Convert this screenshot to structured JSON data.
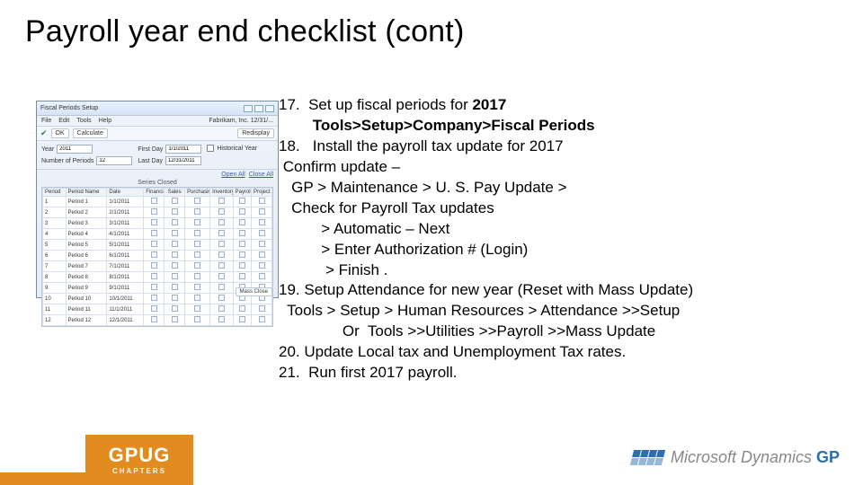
{
  "title": "Payroll year end checklist (cont)",
  "checklist": {
    "l1a": "17.  Set up fiscal periods for ",
    "l1b": "2017",
    "l2a": "        ",
    "l2b": "Tools>Setup>Company>Fiscal Periods",
    "l3": "18.   Install the payroll tax update for 2017",
    "l4": " Confirm update –",
    "l5": "   GP > Maintenance > U. S. Pay Update >",
    "l6": "   Check for Payroll Tax updates",
    "l7": "          > Automatic – Next",
    "l8": "          > Enter Authorization # (Login)",
    "l9": "           > Finish .",
    "l10": "19. Setup Attendance for new year (Reset with Mass Update)",
    "l11": "  Tools > Setup > Human Resources > Attendance >>Setup",
    "l12": "               Or  Tools >>Utilities >>Payroll >>Mass Update",
    "l13": "20. Update Local tax and Unemployment Tax rates.",
    "l14": "21.  Run first 2017 payroll."
  },
  "window": {
    "title": "Fiscal Periods Setup",
    "menu": [
      "File",
      "Edit",
      "Tools",
      "Help"
    ],
    "company": "Fabrikam, Inc.  12/31/...",
    "toolbar": {
      "ok": "OK",
      "calc": "Calculate",
      "redisplay": "Redisplay"
    },
    "params": {
      "year_label": "Year",
      "year": "2011",
      "num_label": "Number of Periods",
      "num": "12",
      "first_label": "First Day",
      "first": "1/1/2011",
      "last_label": "Last Day",
      "last": "12/31/2011",
      "hist_label": "Historical Year"
    },
    "links": {
      "open": "Open All",
      "close": "Close All"
    },
    "series_closed": "Series Closed",
    "columns": [
      "Period",
      "Period Name",
      "Date",
      "Financial",
      "Sales",
      "Purchasing",
      "Inventory",
      "Payroll",
      "Project"
    ],
    "rows": [
      {
        "p": "1",
        "n": "Period 1",
        "d": "1/1/2011"
      },
      {
        "p": "2",
        "n": "Period 2",
        "d": "2/1/2011"
      },
      {
        "p": "3",
        "n": "Period 3",
        "d": "3/1/2011"
      },
      {
        "p": "4",
        "n": "Period 4",
        "d": "4/1/2011"
      },
      {
        "p": "5",
        "n": "Period 5",
        "d": "5/1/2011"
      },
      {
        "p": "6",
        "n": "Period 6",
        "d": "6/1/2011"
      },
      {
        "p": "7",
        "n": "Period 7",
        "d": "7/1/2011"
      },
      {
        "p": "8",
        "n": "Period 8",
        "d": "8/1/2011"
      },
      {
        "p": "9",
        "n": "Period 9",
        "d": "9/1/2011"
      },
      {
        "p": "10",
        "n": "Period 10",
        "d": "10/1/2011"
      },
      {
        "p": "11",
        "n": "Period 11",
        "d": "11/1/2011"
      },
      {
        "p": "12",
        "n": "Period 12",
        "d": "12/1/2011"
      }
    ],
    "mass_close": "Mass Close"
  },
  "footer": {
    "gpug": "GPUG",
    "gpug_sub": "CHAPTERS",
    "ms": "Microsoft Dynamics ",
    "gp": "GP"
  }
}
